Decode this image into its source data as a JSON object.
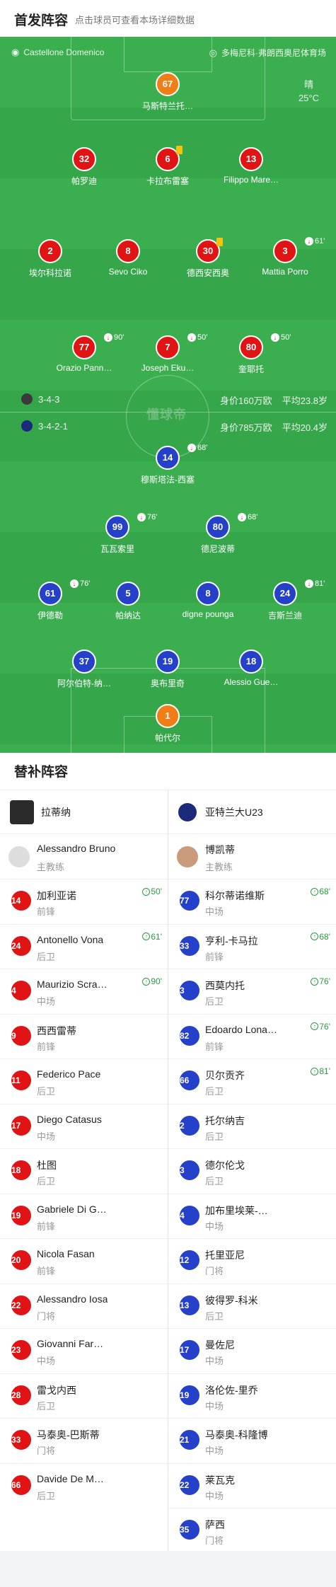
{
  "header": {
    "title": "首发阵容",
    "subtitle": "点击球员可查看本场详细数据"
  },
  "pitch": {
    "home_venue": "Castellone Domenico",
    "away_venue": "多梅尼科·弗朗西奥尼体育场",
    "weather": "晴",
    "temperature": "25°C",
    "watermark": "懂球帝",
    "home_formation": "3-4-3",
    "away_formation": "3-4-2-1",
    "home_value": "身价160万欧",
    "home_age": "平均23.8岁",
    "away_value": "身价785万欧",
    "away_age": "平均20.4岁"
  },
  "home_lineup": [
    {
      "num": "67",
      "name": "马斯特兰托…",
      "color": "orange"
    },
    {
      "num": "32",
      "name": "帕罗迪"
    },
    {
      "num": "6",
      "name": "卡拉布雷塞",
      "card": true
    },
    {
      "num": "13",
      "name": "Filippo Mare…"
    },
    {
      "num": "2",
      "name": "埃尔科拉诺"
    },
    {
      "num": "8",
      "name": "Sevo Ciko"
    },
    {
      "num": "30",
      "name": "德西安西奥",
      "card": true
    },
    {
      "num": "3",
      "name": "Mattia Porro",
      "sub": "61'"
    },
    {
      "num": "77",
      "name": "Orazio Pann…",
      "sub": "90'"
    },
    {
      "num": "7",
      "name": "Joseph Eku…",
      "sub": "50'"
    },
    {
      "num": "80",
      "name": "奎耶托",
      "sub": "50'"
    }
  ],
  "away_lineup": [
    {
      "num": "14",
      "name": "穆斯塔法-西塞",
      "sub": "68'"
    },
    {
      "num": "99",
      "name": "瓦瓦索里",
      "sub": "76'"
    },
    {
      "num": "80",
      "name": "德尼波蒂",
      "sub": "68'"
    },
    {
      "num": "61",
      "name": "伊德勒",
      "sub": "76'"
    },
    {
      "num": "5",
      "name": "帕纳达"
    },
    {
      "num": "8",
      "name": "digne pounga"
    },
    {
      "num": "24",
      "name": "吉斯兰迪",
      "sub": "81'"
    },
    {
      "num": "37",
      "name": "阿尔伯特-纳…"
    },
    {
      "num": "19",
      "name": "奥布里奇"
    },
    {
      "num": "18",
      "name": "Alessio Gue…"
    },
    {
      "num": "1",
      "name": "帕代尔",
      "color": "orange"
    }
  ],
  "subs": {
    "title": "替补阵容",
    "home_team": "拉蒂纳",
    "away_team": "亚特兰大U23",
    "home_coach": {
      "name": "Alessandro Bruno",
      "role": "主教练"
    },
    "away_coach": {
      "name": "博凯蒂",
      "role": "主教练"
    },
    "home": [
      {
        "num": "14",
        "name": "加利亚诺",
        "pos": "前锋",
        "time": "50'"
      },
      {
        "num": "24",
        "name": "Antonello Vona",
        "pos": "后卫",
        "time": "61'"
      },
      {
        "num": "4",
        "name": "Maurizio Scra…",
        "pos": "中场",
        "time": "90'"
      },
      {
        "num": "9",
        "name": "西西雷蒂",
        "pos": "前锋"
      },
      {
        "num": "11",
        "name": "Federico Pace",
        "pos": "后卫"
      },
      {
        "num": "17",
        "name": "Diego Catasus",
        "pos": "中场"
      },
      {
        "num": "18",
        "name": "杜图",
        "pos": "后卫"
      },
      {
        "num": "19",
        "name": "Gabriele Di G…",
        "pos": "前锋"
      },
      {
        "num": "20",
        "name": "Nicola Fasan",
        "pos": "前锋"
      },
      {
        "num": "22",
        "name": "Alessandro Iosa",
        "pos": "门将"
      },
      {
        "num": "23",
        "name": "Giovanni Far…",
        "pos": "中场"
      },
      {
        "num": "28",
        "name": "雷戈内西",
        "pos": "后卫"
      },
      {
        "num": "33",
        "name": "马泰奥-巴斯蒂",
        "pos": "门将"
      },
      {
        "num": "66",
        "name": "Davide De M…",
        "pos": "后卫"
      }
    ],
    "away": [
      {
        "num": "77",
        "name": "科尔蒂诺维斯",
        "pos": "中场",
        "time": "68'"
      },
      {
        "num": "33",
        "name": "亨利-卡马拉",
        "pos": "前锋",
        "time": "68'"
      },
      {
        "num": "3",
        "name": "西莫内托",
        "pos": "后卫",
        "time": "76'"
      },
      {
        "num": "82",
        "name": "Edoardo Lona…",
        "pos": "前锋",
        "time": "76'"
      },
      {
        "num": "66",
        "name": "贝尔贡齐",
        "pos": "后卫",
        "time": "81'"
      },
      {
        "num": "2",
        "name": "托尔纳吉",
        "pos": "后卫"
      },
      {
        "num": "3",
        "name": "德尔伦戈",
        "pos": "后卫"
      },
      {
        "num": "4",
        "name": "加布里埃莱-…",
        "pos": "中场"
      },
      {
        "num": "12",
        "name": "托里亚尼",
        "pos": "门将"
      },
      {
        "num": "13",
        "name": "彼得罗-科米",
        "pos": "后卫"
      },
      {
        "num": "17",
        "name": "曼佐尼",
        "pos": "中场"
      },
      {
        "num": "19",
        "name": "洛伦佐-里乔",
        "pos": "中场"
      },
      {
        "num": "21",
        "name": "马泰奥-科隆博",
        "pos": "中场"
      },
      {
        "num": "22",
        "name": "莱瓦克",
        "pos": "中场"
      },
      {
        "num": "35",
        "name": "萨西",
        "pos": "门将"
      }
    ]
  },
  "colors": {
    "pitch": "#3bae4f",
    "home": "#e01414",
    "away": "#2540c9",
    "gk": "#f07e17",
    "sub_green": "#2a9a44"
  }
}
